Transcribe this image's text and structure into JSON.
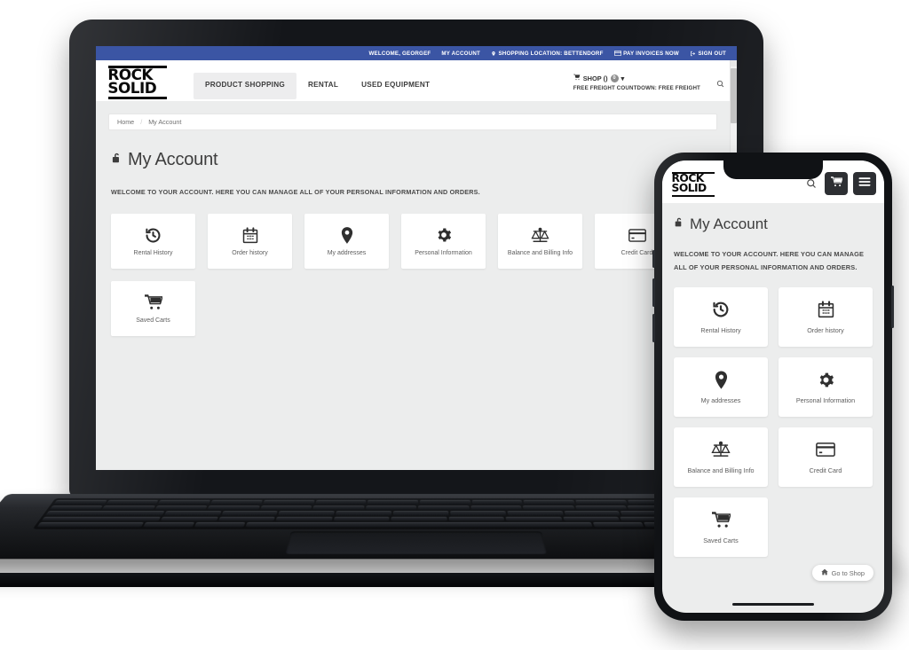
{
  "brand": {
    "logo_line1": "ROCK",
    "logo_line2": "SOLID"
  },
  "desktop": {
    "topbar": {
      "welcome": "WELCOME, GEORGEF",
      "my_account": "MY ACCOUNT",
      "shopping_location": "SHOPPING LOCATION: BETTENDORF",
      "pay_invoices": "PAY INVOICES NOW",
      "sign_out": "SIGN OUT",
      "location_icon": "map-pin-icon",
      "pay_icon": "credit-card-icon",
      "signout_icon": "sign-out-icon",
      "background_color": "#3b55a4"
    },
    "mainnav": {
      "tabs": [
        {
          "label": "PRODUCT SHOPPING",
          "active": true
        },
        {
          "label": "RENTAL",
          "active": false
        },
        {
          "label": "USED EQUIPMENT",
          "active": false
        }
      ]
    },
    "cart": {
      "shop_label": "SHOP ()",
      "count": "0",
      "caret": "▾",
      "freight": "FREE FREIGHT COUNTDOWN: FREE FREIGHT",
      "search_icon": "search-icon"
    },
    "breadcrumb": {
      "items": [
        "Home",
        "My Account"
      ],
      "separator": "/"
    },
    "page_title": "My Account",
    "page_title_icon": "unlock-icon",
    "welcome_text": "WELCOME TO YOUR ACCOUNT. HERE YOU CAN MANAGE ALL OF YOUR PERSONAL INFORMATION AND ORDERS.",
    "cards": [
      {
        "label": "Rental History",
        "icon": "history-icon"
      },
      {
        "label": "Order history",
        "icon": "calendar-icon"
      },
      {
        "label": "My addresses",
        "icon": "map-pin-icon"
      },
      {
        "label": "Personal Information",
        "icon": "gear-icon"
      },
      {
        "label": "Balance and Billing Info",
        "icon": "scales-icon"
      },
      {
        "label": "Credit Card",
        "icon": "credit-card-icon"
      },
      {
        "label": "Saved Carts",
        "icon": "shopping-cart-icon"
      }
    ]
  },
  "mobile": {
    "header": {
      "search_icon": "search-icon",
      "cart_icon": "shopping-cart-icon",
      "menu_icon": "hamburger-menu-icon"
    },
    "page_title": "My Account",
    "page_title_icon": "unlock-icon",
    "welcome_line1": "WELCOME TO YOUR ACCOUNT. HERE YOU CAN MANAGE",
    "welcome_line2": "ALL OF YOUR PERSONAL INFORMATION AND ORDERS.",
    "cards": [
      {
        "label": "Rental History",
        "icon": "history-icon"
      },
      {
        "label": "Order history",
        "icon": "calendar-icon"
      },
      {
        "label": "My addresses",
        "icon": "map-pin-icon"
      },
      {
        "label": "Personal Information",
        "icon": "gear-icon"
      },
      {
        "label": "Balance and Billing Info",
        "icon": "scales-icon"
      },
      {
        "label": "Credit Card",
        "icon": "credit-card-icon"
      },
      {
        "label": "Saved Carts",
        "icon": "shopping-cart-icon"
      }
    ],
    "go_to_shop": "Go to Shop",
    "go_to_shop_icon": "home-icon"
  }
}
